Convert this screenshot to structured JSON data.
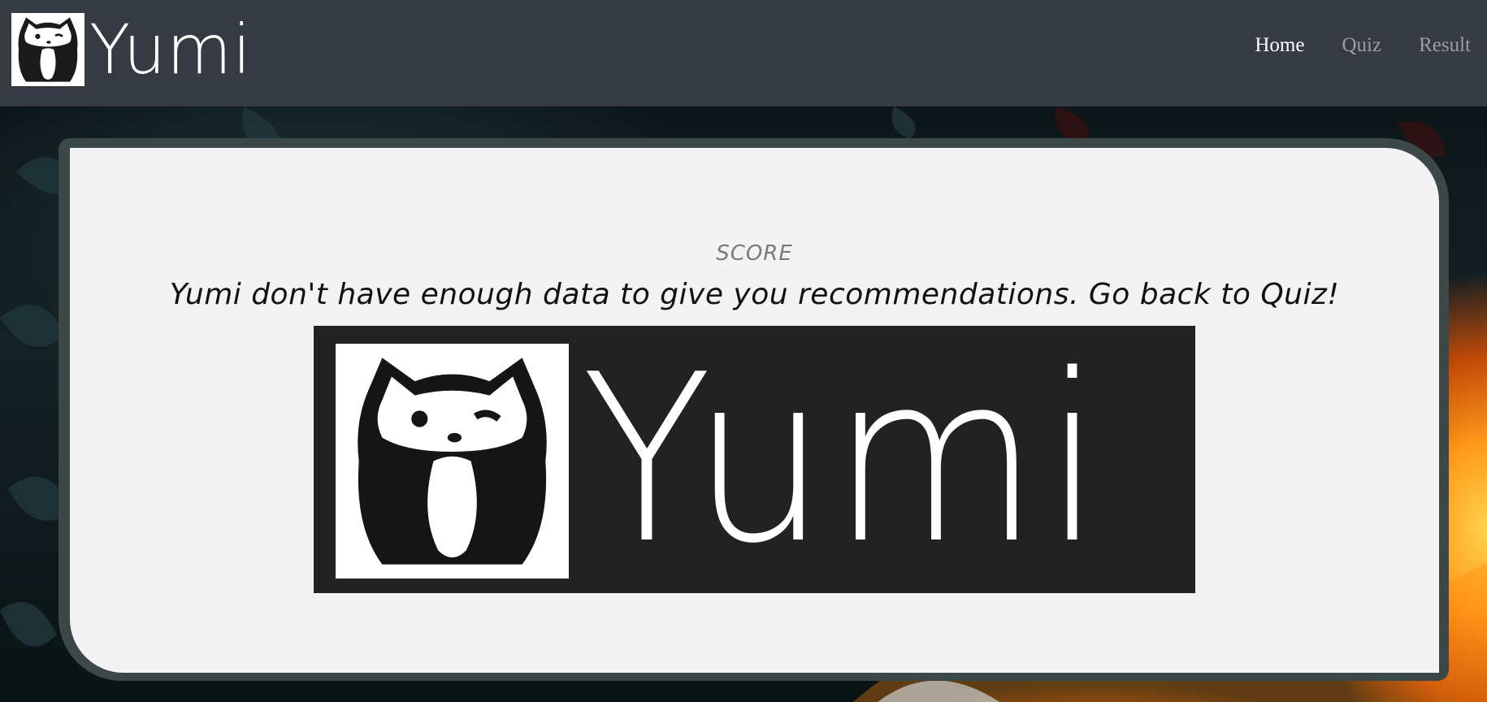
{
  "brand": {
    "name": "Yumi"
  },
  "nav": {
    "items": [
      {
        "label": "Home",
        "active": true
      },
      {
        "label": "Quiz",
        "active": false
      },
      {
        "label": "Result",
        "active": false
      }
    ]
  },
  "result": {
    "heading": "SCORE",
    "message": "Yumi don't have enough data to give you recommendations. Go back to Quiz!",
    "logo_text": "Yumi"
  },
  "colors": {
    "navbar": "#353a43",
    "card_border": "#3c4748",
    "card_bg": "#f3f3f3",
    "logo_bg": "#222222"
  }
}
